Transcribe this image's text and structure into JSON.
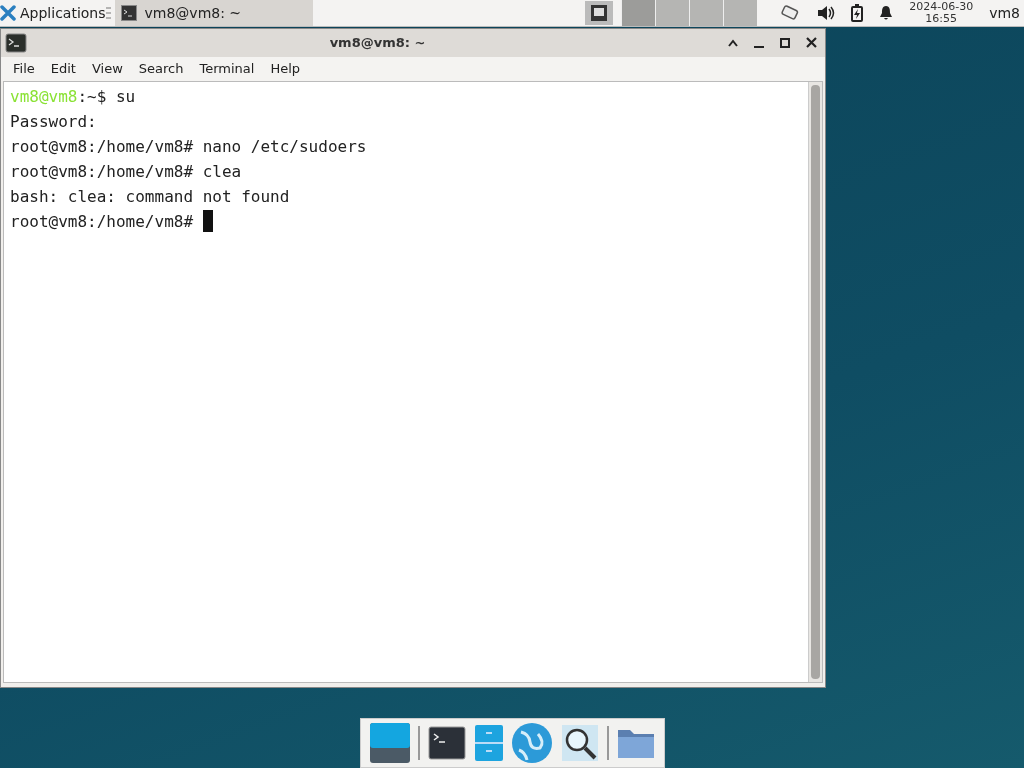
{
  "panel": {
    "applications_label": "Applications",
    "tasks": [
      {
        "title": "vm8@vm8: ~",
        "selected": false
      }
    ],
    "workspaces": [
      {
        "selected": true
      },
      {
        "selected": false
      },
      {
        "selected": false
      },
      {
        "selected": false
      }
    ],
    "clock": {
      "date": "2024-06-30",
      "time": "16:55"
    },
    "user": "vm8"
  },
  "window": {
    "title": "vm8@vm8: ~",
    "menu": [
      "File",
      "Edit",
      "View",
      "Search",
      "Terminal",
      "Help"
    ],
    "lines": [
      {
        "prompt": "vm8@vm8",
        "text": ":~$ su"
      },
      {
        "text": "Password:"
      },
      {
        "text": "root@vm8:/home/vm8# nano /etc/sudoers"
      },
      {
        "text": "root@vm8:/home/vm8# clea"
      },
      {
        "text": "bash: clea: command not found"
      },
      {
        "text": "root@vm8:/home/vm8#",
        "cursor": true
      }
    ]
  }
}
